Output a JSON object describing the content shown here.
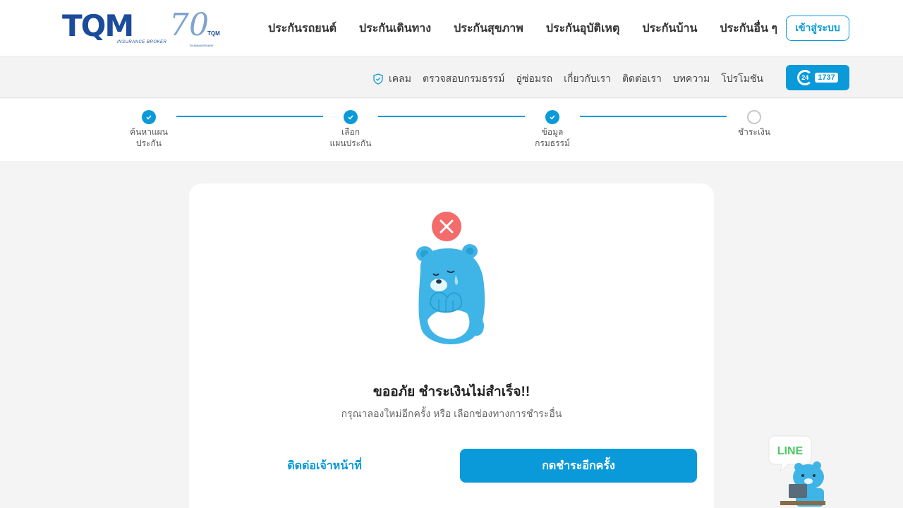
{
  "brand": {
    "logo_text": "TQM",
    "logo_sub": "INSURANCE BROKER",
    "anniversary_num": "70",
    "anniversary_label": "TQM",
    "anniversary_tag": "TH ANNIVERSARY"
  },
  "main_nav": [
    {
      "label": "ประกันรถยนต์"
    },
    {
      "label": "ประกันเดินทาง"
    },
    {
      "label": "ประกันสุขภาพ"
    },
    {
      "label": "ประกันอุบัติเหตุ"
    },
    {
      "label": "ประกันบ้าน"
    },
    {
      "label": "ประกันอื่น ๆ"
    }
  ],
  "login_label": "เข้าสู่ระบบ",
  "sub_nav": [
    {
      "label": "เคลม",
      "icon": "shield-check-icon"
    },
    {
      "label": "ตรวจสอบกรมธรรม์"
    },
    {
      "label": "อู่ซ่อมรถ"
    },
    {
      "label": "เกี่ยวกับเรา"
    },
    {
      "label": "ติดต่อเรา"
    },
    {
      "label": "บทความ"
    },
    {
      "label": "โปรโมชัน"
    }
  ],
  "hotline": {
    "hours": "24",
    "number": "1737"
  },
  "steps": [
    {
      "label_1": "ค้นหาแผน",
      "label_2": "ประกัน",
      "status": "done"
    },
    {
      "label_1": "เลือก",
      "label_2": "แผนประกัน",
      "status": "done"
    },
    {
      "label_1": "ข้อมูล",
      "label_2": "กรมธรรม์",
      "status": "done"
    },
    {
      "label_1": "ชำระเงิน",
      "label_2": "",
      "status": "pending"
    }
  ],
  "result": {
    "title": "ขออภัย ชำระเงินไม่สำเร็จ!!",
    "description": "กรุณาลองใหม่อีกครั้ง หรือ เลือกช่องทางการชำระอื่น",
    "contact_label": "ติดต่อเจ้าหน้าที่",
    "retry_label": "กดชำระอีกครั้ง"
  },
  "line_widget": {
    "label": "LINE"
  },
  "colors": {
    "primary": "#0a9ad9",
    "error": "#f46b6b",
    "brand": "#1b4b9b"
  }
}
